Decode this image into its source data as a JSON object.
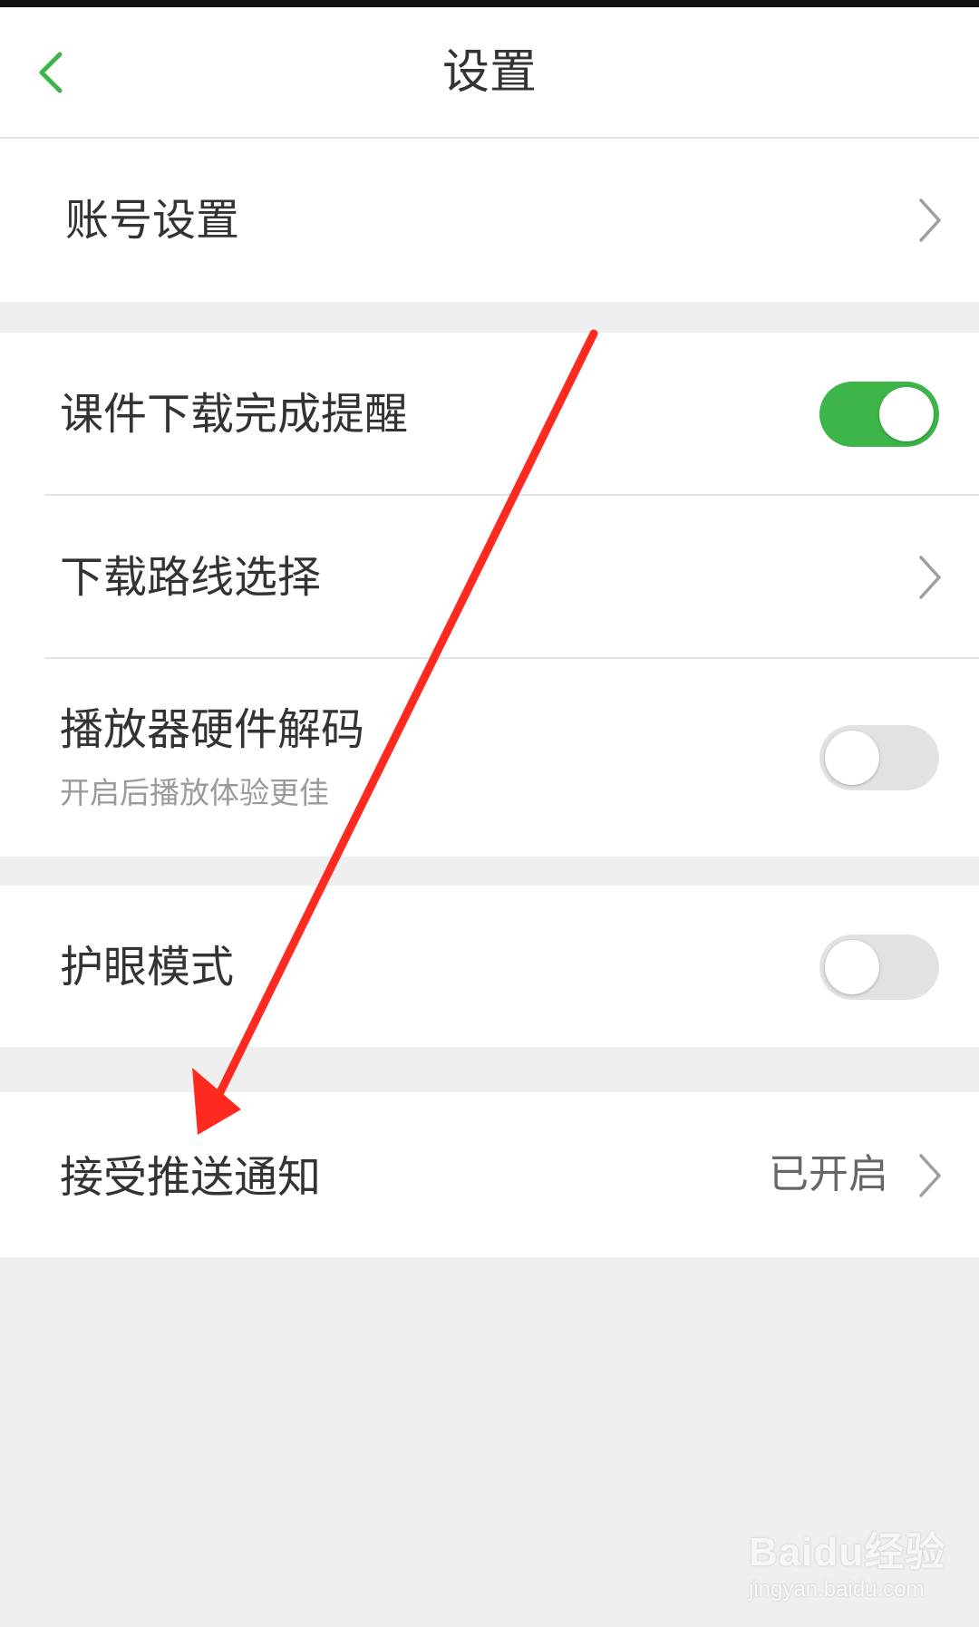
{
  "header": {
    "title": "设置",
    "back_icon": "chevron-left-icon"
  },
  "sections": [
    {
      "items": [
        {
          "label": "账号设置",
          "control": "chevron"
        }
      ]
    },
    {
      "items": [
        {
          "label": "课件下载完成提醒",
          "control": "toggle",
          "toggle_on": true
        },
        {
          "label": "下载路线选择",
          "control": "chevron"
        },
        {
          "label": "播放器硬件解码",
          "sublabel": "开启后播放体验更佳",
          "control": "toggle",
          "toggle_on": false
        }
      ]
    },
    {
      "items": [
        {
          "label": "护眼模式",
          "control": "toggle",
          "toggle_on": false
        }
      ]
    },
    {
      "items": [
        {
          "label": "接受推送通知",
          "value": "已开启",
          "control": "chevron"
        }
      ]
    }
  ],
  "watermark": {
    "brand": "Baidu经验",
    "url": "jingyan.baidu.com"
  },
  "colors": {
    "accent_green": "#3db549",
    "annotation_red": "#ff2a1f",
    "background": "#efefef"
  }
}
